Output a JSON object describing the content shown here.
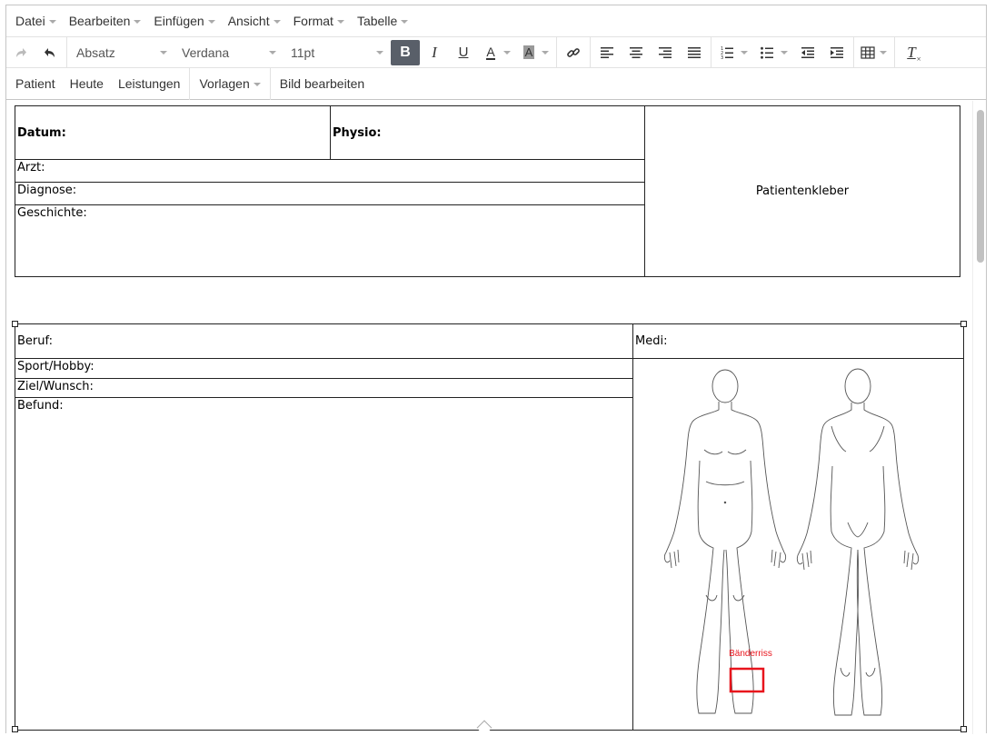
{
  "menubar": {
    "items": [
      "Datei",
      "Bearbeiten",
      "Einfügen",
      "Ansicht",
      "Format",
      "Tabelle"
    ]
  },
  "toolbar": {
    "block_format": "Absatz",
    "font_family": "Verdana",
    "font_size": "11pt"
  },
  "custom_bar": {
    "items": [
      "Patient",
      "Heute",
      "Leistungen",
      "Vorlagen",
      "Bild bearbeiten"
    ]
  },
  "doc": {
    "table1": {
      "datum": "Datum:",
      "physio": "Physio:",
      "patientenkleber": "Patientenkleber",
      "arzt": "Arzt:",
      "diagnose": "Diagnose:",
      "geschichte": "Geschichte:"
    },
    "table2": {
      "beruf": "Beruf:",
      "medi": "Medi:",
      "sport": "Sport/Hobby:",
      "ziel": "Ziel/Wunsch:",
      "befund": "Befund:"
    },
    "annotation": {
      "label": "Bänderriss",
      "color": "#e8141c"
    }
  }
}
